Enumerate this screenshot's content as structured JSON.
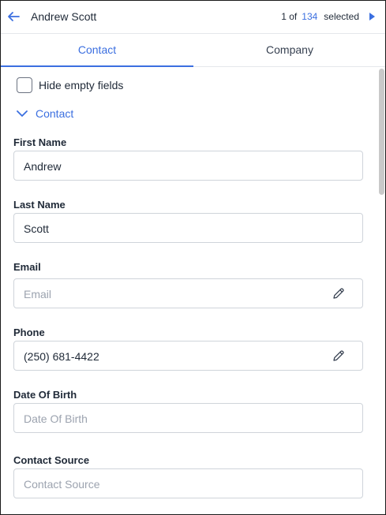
{
  "header": {
    "title": "Andrew Scott",
    "pager_current": "1 of",
    "pager_total": "134",
    "pager_suffix": "selected"
  },
  "tabs": [
    {
      "label": "Contact",
      "active": true
    },
    {
      "label": "Company",
      "active": false
    }
  ],
  "options": {
    "hide_empty_label": "Hide empty fields",
    "hide_empty_checked": false
  },
  "section": {
    "label": "Contact",
    "expanded": true
  },
  "fields": {
    "first_name": {
      "label": "First Name",
      "value": "Andrew"
    },
    "last_name": {
      "label": "Last Name",
      "value": "Scott"
    },
    "email": {
      "label": "Email",
      "value": "",
      "placeholder": "Email"
    },
    "phone": {
      "label": "Phone",
      "value": "(250) 681-4422"
    },
    "dob": {
      "label": "Date Of Birth",
      "value": "",
      "placeholder": "Date Of Birth"
    },
    "source": {
      "label": "Contact Source",
      "value": "",
      "placeholder": "Contact Source"
    }
  },
  "colors": {
    "accent": "#3b6fe0",
    "border": "#cfd4da",
    "placeholder": "#9ca3af"
  }
}
